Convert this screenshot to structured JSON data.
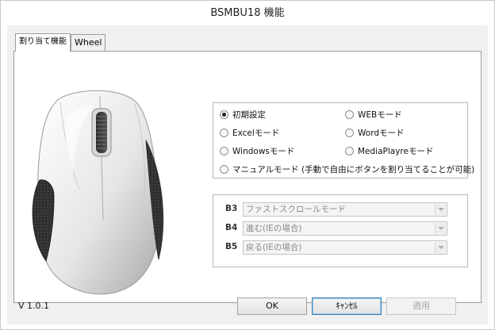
{
  "window": {
    "title": "BSMBU18 機能"
  },
  "tabs": [
    {
      "label": "割り当て機能",
      "active": true
    },
    {
      "label": "Wheel",
      "active": false
    }
  ],
  "mode_options": [
    {
      "label": "初期設定",
      "checked": true
    },
    {
      "label": "WEBモード",
      "checked": false
    },
    {
      "label": "Excelモード",
      "checked": false
    },
    {
      "label": "Wordモード",
      "checked": false
    },
    {
      "label": "Windowsモード",
      "checked": false
    },
    {
      "label": "MediaPlayreモード",
      "checked": false
    },
    {
      "label": "マニュアルモード (手動で自由にボタンを割り当てることが可能)",
      "checked": false
    }
  ],
  "button_assignments": [
    {
      "label": "B3",
      "value": "ファストスクロールモード"
    },
    {
      "label": "B4",
      "value": "進む(IEの場合)"
    },
    {
      "label": "B5",
      "value": "戻る(IEの場合)"
    }
  ],
  "footer": {
    "version": "V 1.0.1",
    "ok_label": "OK",
    "cancel_label": "ｷｬﾝｾﾙ",
    "apply_label": "適用"
  },
  "colors": {
    "dialog_bg": "#f0f0f0",
    "panel_bg": "#ffffff",
    "focus_border": "#3c7fb1"
  },
  "icons": [
    "mouse-product-image",
    "radio-icon",
    "dropdown-arrow-icon"
  ]
}
